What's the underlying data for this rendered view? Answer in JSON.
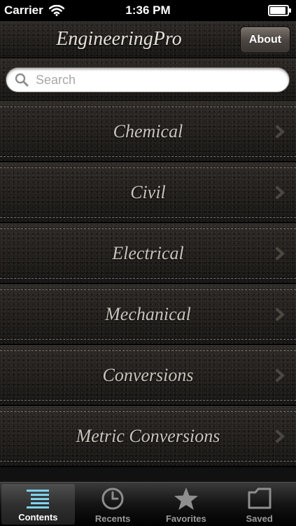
{
  "status_bar": {
    "carrier": "Carrier",
    "time": "1:36 PM",
    "battery_level": 0.85
  },
  "nav": {
    "title": "EngineeringPro",
    "about_label": "About"
  },
  "search": {
    "placeholder": "Search"
  },
  "categories": [
    {
      "label": "Chemical"
    },
    {
      "label": "Civil"
    },
    {
      "label": "Electrical"
    },
    {
      "label": "Mechanical"
    },
    {
      "label": "Conversions"
    },
    {
      "label": "Metric Conversions"
    }
  ],
  "tabs": [
    {
      "label": "Contents",
      "icon": "contents-list-icon",
      "active": true
    },
    {
      "label": "Recents",
      "icon": "clock-icon",
      "active": false
    },
    {
      "label": "Favorites",
      "icon": "star-icon",
      "active": false
    },
    {
      "label": "Saved",
      "icon": "folder-icon",
      "active": false
    }
  ],
  "colors": {
    "tab_active_accent": "#7fd3ef",
    "title_text": "#e6e2da"
  }
}
